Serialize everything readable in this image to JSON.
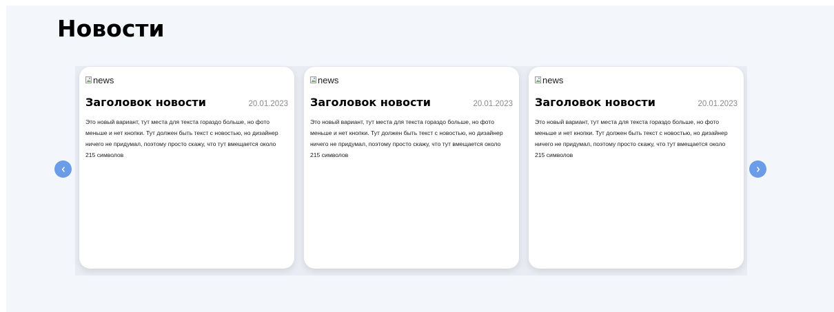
{
  "section": {
    "title": "Новости"
  },
  "cards": [
    {
      "image_alt": "news",
      "title": "Заголовок новости",
      "date": "20.01.2023",
      "text": "Это новый вариант, тут места для текста гораздо больше, но фото меньше и нет кнопки. Тут должен быть текст с новостью, но дизайнер ничего не придумал, поэтому просто скажу, что тут вмещается около 215 символов"
    },
    {
      "image_alt": "news",
      "title": "Заголовок новости",
      "date": "20.01.2023",
      "text": "Это новый вариант, тут места для текста гораздо больше, но фото меньше и нет кнопки. Тут должен быть текст с новостью, но дизайнер ничего не придумал, поэтому просто скажу, что тут вмещается около 215 символов"
    },
    {
      "image_alt": "news",
      "title": "Заголовок новости",
      "date": "20.01.2023",
      "text": "Это новый вариант, тут места для текста гораздо больше, но фото меньше и нет кнопки. Тут должен быть текст с новостью, но дизайнер ничего не придумал, поэтому просто скажу, что тут вмещается около 215 символов"
    }
  ],
  "navigation": {
    "prev_icon": "chevron-left-icon",
    "next_icon": "chevron-right-icon"
  },
  "colors": {
    "section_background": "#f3f7fc",
    "arrow_background": "#6b9ce8",
    "card_background": "#ffffff",
    "date_color": "#8a8a8a"
  }
}
